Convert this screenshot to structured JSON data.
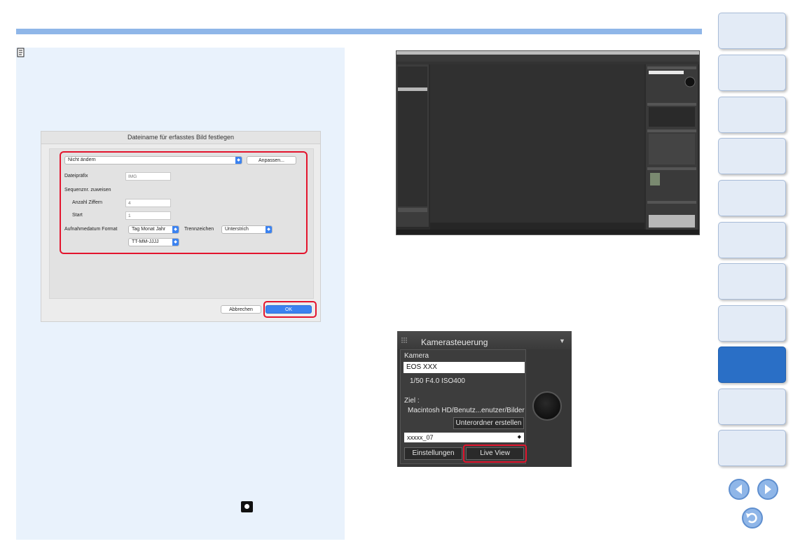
{
  "dialog": {
    "title": "Dateiname für erfasstes Bild festlegen",
    "mode_select": "Nicht ändern",
    "customize_button": "Anpassen...",
    "prefix_label": "Dateipräfix",
    "prefix_value": "IMG",
    "sequence_label": "Sequenznr. zuweisen",
    "digits_label": "Anzahl Ziffern",
    "digits_value": "4",
    "start_label": "Start",
    "start_value": "1",
    "date_format_label": "Aufnahmedatum Format",
    "date_format_select": "Tag Monat Jahr",
    "separator_label": "Trennzeichen",
    "separator_select": "Unterstrich",
    "date_pattern_select": "TT-MM-JJJJ",
    "cancel_button": "Abbrechen",
    "ok_button": "OK"
  },
  "kamera_panel": {
    "title": "Kamerasteuerung",
    "camera_label": "Kamera",
    "camera_name": "EOS XXX",
    "settings": "1/50  F4.0  ISO400",
    "target_label": "Ziel :",
    "target_path": "Macintosh HD/Benutz...enutzer/Bilder",
    "create_folder_button": "Unterordner erstellen",
    "folder_select": "xxxxx_07",
    "settings_button": "Einstellungen",
    "live_view_button": "Live View"
  },
  "nav": {
    "tab_count_active_index": 8
  },
  "colors": {
    "accent_blue": "#2a6fc6",
    "highlight_red": "#e3142d",
    "note_bg": "#e9f2fc",
    "topbar": "#8fb6e8"
  }
}
